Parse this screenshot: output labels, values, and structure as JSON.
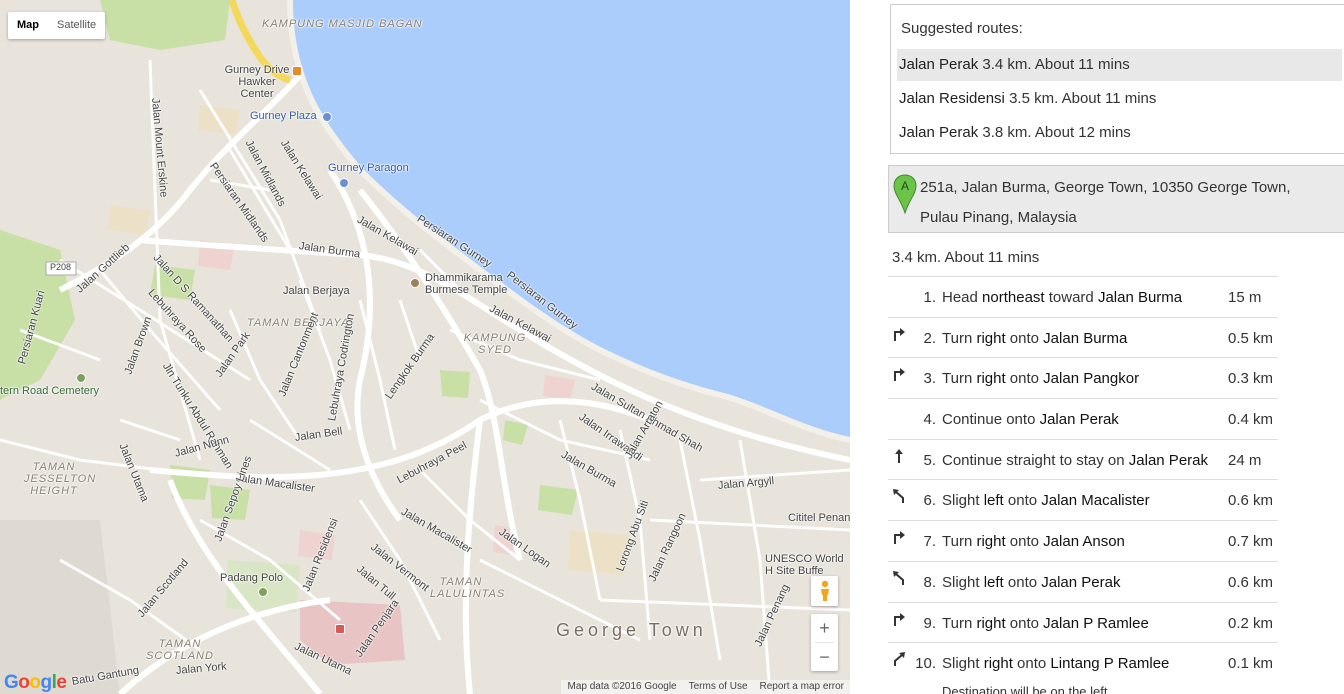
{
  "map": {
    "type_buttons": [
      "Map",
      "Satellite"
    ],
    "active_type": "Map",
    "zoom_in": "+",
    "zoom_out": "−",
    "logo": "Google",
    "attribution": [
      "Map data ©2016 Google",
      "Terms of Use",
      "Report a map error"
    ],
    "colors": {
      "sea": "#abcdfb",
      "land": "#e8e4dc",
      "park": "#c8dfa6",
      "road": "#ffffff",
      "highway": "#f3d85a",
      "hospital": "#e8c4c4"
    },
    "labels": {
      "kampung_masjid_bagan": "KAMPUNG MASJID BAGAN",
      "gurney_drive": "Gurney Drive Hawker Center",
      "gurney_plaza": "Gurney Plaza",
      "gurney_paragon": "Gurney Paragon",
      "jalan_mount_erskine": "Jalan Mount Erskine",
      "jalan_midlands": "Jalan Midlands",
      "persiaran_midlands": "Persiaran Midlands",
      "jalan_kelawai_1": "Jalan Kelawai",
      "jalan_kelawai_2": "Jalan Kelawai",
      "jalan_kelawai_3": "Jalan Kelawai",
      "persiaran_gurney_1": "Persiaran Gurney",
      "persiaran_gurney_2": "Persiaran Gurney",
      "jalan_burma_1": "Jalan Burma",
      "jalan_burma_2": "Jalan Burma",
      "jalan_ds_ramanathan": "Jalan D S Ramanathan",
      "jalan_gottlieb": "Jalan Gottlieb",
      "p208": "P208",
      "persiaran_kuari": "Persiaran Kuari",
      "lebuhraya_rose": "Lebuhraya Rose",
      "jalan_berjaya": "Jalan Berjaya",
      "dhammikarama": "Dhammikarama Burmese Temple",
      "taman_berjaya": "TAMAN BERJAYA",
      "kampung_syed": "KAMPUNG SYED",
      "jalan_brown": "Jalan Brown",
      "jln_tunku_abdul_rahman": "Jln Tunku Abdul Rahman",
      "jalan_park": "Jalan Park",
      "jalan_cantonment": "Jalan Cantonment",
      "lebuhraya_codrington": "Lebuhraya Codrington",
      "lengkok_burma": "Lengkok Burma",
      "jalan_sultan_ahmad_shah": "Jalan Sultan Ahmad Shah",
      "jalan_irrawaddi": "Jalan Irrawaddi",
      "jalan_arraton": "Jalan Arraton",
      "western_road_cemetery": "tern Road Cemetery",
      "jalan_utama_1": "Jalan Utama",
      "jalan_utama_2": "Jalan Utama",
      "jalan_nunn": "Jalan Nunn",
      "jalan_bell": "Jalan Bell",
      "taman_jesselton": "TAMAN JESSELTON HEIGHT",
      "jalan_macalister_1": "Jalan Macalister",
      "jalan_macalister_2": "Jalan Macalister",
      "lebuhraya_peel": "Lebuhraya Peel",
      "jalan_argyll": "Jalan Argyll",
      "cititel": "Cititel Penan",
      "jalan_logan": "Jalan Logan",
      "jalan_sepoy_lines": "Jalan Sepoy Lines",
      "jalan_vermont": "Jalan Vermont",
      "jalan_residensi": "Jalan Residensi",
      "jalan_tull": "Jalan Tull",
      "padang_polo": "Padang Polo",
      "taman_lalulintas": "TAMAN LALULINTAS",
      "lorong_abu_siti": "Lorong Abu Siti",
      "jalan_rangoon": "Jalan Rangoon",
      "unesco": "UNESCO World H Site Buffe",
      "jalan_scotland": "Jalan Scotland",
      "taman_scotland": "TAMAN SCOTLAND",
      "jalan_york": "Jalan York",
      "batu_gantung": "Batu Gantung",
      "jalan_penjara": "Jalan Penjara",
      "george_town": "George Town",
      "jalan_penang": "Jalan Penang"
    }
  },
  "panel": {
    "suggested_title": "Suggested routes:",
    "routes": [
      {
        "name": "Jalan Perak",
        "detail": "3.4 km. About 11 mins",
        "selected": true
      },
      {
        "name": "Jalan Residensi",
        "detail": "3.5 km. About 11 mins",
        "selected": false
      },
      {
        "name": "Jalan Perak",
        "detail": "3.8 km. About 12 mins",
        "selected": false
      }
    ],
    "start": {
      "marker": "A",
      "address": "251a, Jalan Burma, George Town, 10350 George Town, Pulau Pinang, Malaysia"
    },
    "summary": "3.4 km. About 11 mins",
    "steps": [
      {
        "num": "1.",
        "icon": "none",
        "pre": "Head ",
        "b1": "northeast",
        "mid": " toward ",
        "b2": "Jalan Burma",
        "dist": "15 m"
      },
      {
        "num": "2.",
        "icon": "turn-right-icon",
        "pre": "Turn ",
        "b1": "right",
        "mid": " onto ",
        "b2": "Jalan Burma",
        "dist": "0.5 km"
      },
      {
        "num": "3.",
        "icon": "turn-right-icon",
        "pre": "Turn ",
        "b1": "right",
        "mid": " onto ",
        "b2": "Jalan Pangkor",
        "dist": "0.3 km"
      },
      {
        "num": "4.",
        "icon": "none",
        "pre": "Continue onto ",
        "b1": "",
        "mid": "",
        "b2": "Jalan Perak",
        "dist": "0.4 km"
      },
      {
        "num": "5.",
        "icon": "straight-icon",
        "pre": "Continue straight to stay on ",
        "b1": "",
        "mid": "",
        "b2": "Jalan Perak",
        "dist": "24 m"
      },
      {
        "num": "6.",
        "icon": "slight-left-icon",
        "pre": "Slight ",
        "b1": "left",
        "mid": " onto ",
        "b2": "Jalan Macalister",
        "dist": "0.6 km"
      },
      {
        "num": "7.",
        "icon": "turn-right-icon",
        "pre": "Turn ",
        "b1": "right",
        "mid": " onto ",
        "b2": "Jalan Anson",
        "dist": "0.7 km"
      },
      {
        "num": "8.",
        "icon": "slight-left-icon",
        "pre": "Slight ",
        "b1": "left",
        "mid": " onto ",
        "b2": "Jalan Perak",
        "dist": "0.6 km"
      },
      {
        "num": "9.",
        "icon": "turn-right-icon",
        "pre": "Turn ",
        "b1": "right",
        "mid": " onto ",
        "b2": "Jalan P Ramlee",
        "dist": "0.2 km"
      },
      {
        "num": "10.",
        "icon": "slight-right-icon",
        "pre": "Slight ",
        "b1": "right",
        "mid": " onto ",
        "b2": "Lintang P Ramlee",
        "dist": "0.1 km"
      }
    ],
    "destination_note": "Destination will be on the left"
  }
}
